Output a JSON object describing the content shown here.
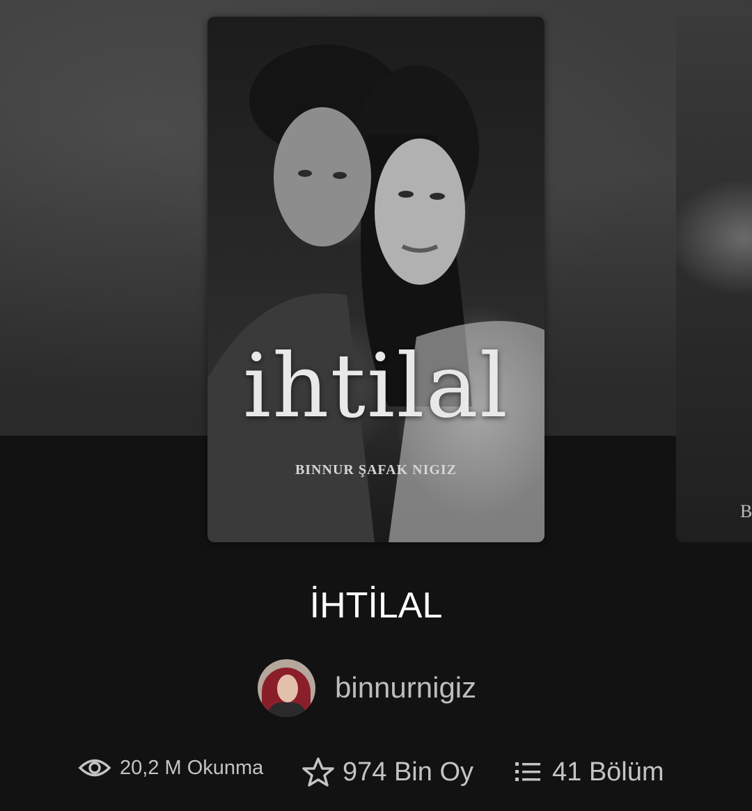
{
  "carousel": {
    "current_cover": {
      "title_art": "ihtilal",
      "author_art": "BINNUR ŞAFAK NIGIZ"
    },
    "next_cover": {
      "visible_letter": "B"
    }
  },
  "book": {
    "title": "İHTİLAL",
    "author": {
      "username": "binnurnigiz"
    },
    "stats": {
      "reads": "20,2 M Okunma",
      "votes": "974 Bin Oy",
      "parts": "41 Bölüm"
    }
  },
  "icons": {
    "reads": "eye-icon",
    "votes": "star-icon",
    "parts": "list-icon"
  },
  "colors": {
    "background": "#121212",
    "title": "#ffffff",
    "secondary_text": "#bdbdbd"
  }
}
